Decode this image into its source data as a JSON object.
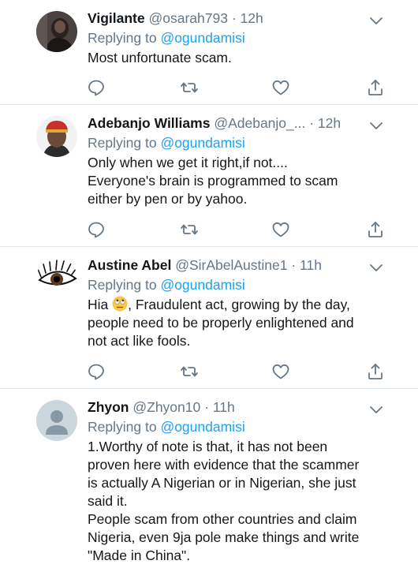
{
  "tweets": [
    {
      "name": "Vigilante",
      "handle": "@osarah793",
      "time": "· 12h",
      "replying_prefix": "Replying to",
      "replying_to": "@ogundamisi",
      "lines": [
        "Most unfortunate scam."
      ],
      "avatar_icon": "photo-avatar-icon"
    },
    {
      "name": "Adebanjo Williams",
      "handle": "@Adebanjo_...",
      "time": "· 12h",
      "replying_prefix": "Replying to",
      "replying_to": "@ogundamisi",
      "lines": [
        "Only when we get it right,if not....",
        "Everyone's brain is programmed to scam",
        "either by pen or by yahoo."
      ],
      "avatar_icon": "photo-avatar-icon"
    },
    {
      "name": "Austine Abel",
      "handle": "@SirAbelAustine1",
      "time": "· 11h",
      "replying_prefix": "Replying to",
      "replying_to": "@ogundamisi",
      "line1_before_emoji": "Hia",
      "line1_after_emoji": ", Fraudulent act, growing by the day,",
      "lines_rest": [
        "people need to be properly enlightened and",
        "not act like fools."
      ],
      "emoji_icon": "face-with-rolling-eyes-emoji",
      "avatar_icon": "eye-avatar-icon"
    },
    {
      "name": "Zhyon",
      "handle": "@Zhyon10",
      "time": "· 11h",
      "replying_prefix": "Replying to",
      "replying_to": "@ogundamisi",
      "lines": [
        "1.Worthy of note is that, it has not been",
        "proven here with evidence that the scammer",
        "is actually A Nigerian or in Nigerian, she just",
        "said it.",
        "People scam from other countries and claim",
        "Nigeria, even 9ja pole make things and write",
        "\"Made in China\"."
      ],
      "avatar_icon": "default-avatar-icon"
    }
  ],
  "action_icons": [
    "reply-icon",
    "retweet-icon",
    "like-icon",
    "share-icon"
  ],
  "colors": {
    "text": "#14171a",
    "secondary": "#657786",
    "link": "#1da1f2",
    "divider": "#e1e8ed",
    "icon": "#657786"
  }
}
